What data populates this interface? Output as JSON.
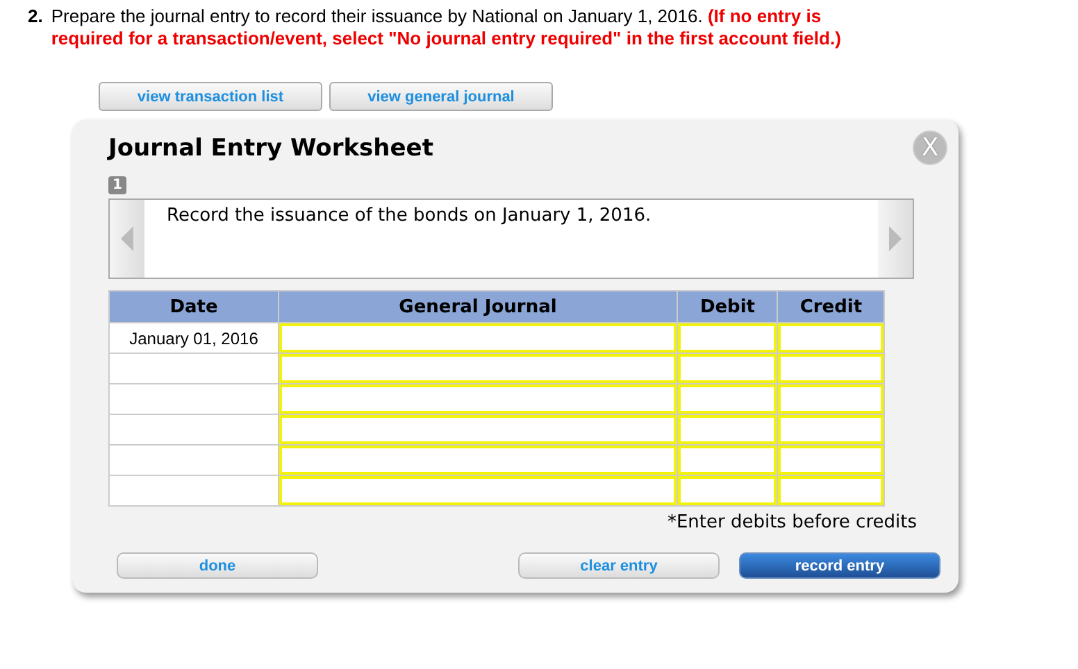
{
  "question": {
    "number": "2.",
    "text": "Prepare the journal entry to record their issuance by National on January 1, 2016.",
    "note": "(If no entry is required for a transaction/event, select \"No journal entry required\" in the first account field.)"
  },
  "top_buttons": [
    "view transaction list",
    "view general journal"
  ],
  "worksheet": {
    "title": "Journal Entry Worksheet",
    "close": "X",
    "page": "1",
    "description": "Record the issuance of the bonds on January 1, 2016.",
    "columns": [
      "Date",
      "General Journal",
      "Debit",
      "Credit"
    ],
    "rows": [
      {
        "date": "January 01, 2016"
      },
      {
        "date": ""
      },
      {
        "date": ""
      },
      {
        "date": ""
      },
      {
        "date": ""
      },
      {
        "date": ""
      }
    ],
    "footnote": "*Enter debits before credits",
    "buttons": [
      {
        "label": "done",
        "kind": "plain"
      },
      {
        "label": "clear entry",
        "kind": "plain"
      },
      {
        "label": "record entry",
        "kind": "primary"
      }
    ]
  }
}
